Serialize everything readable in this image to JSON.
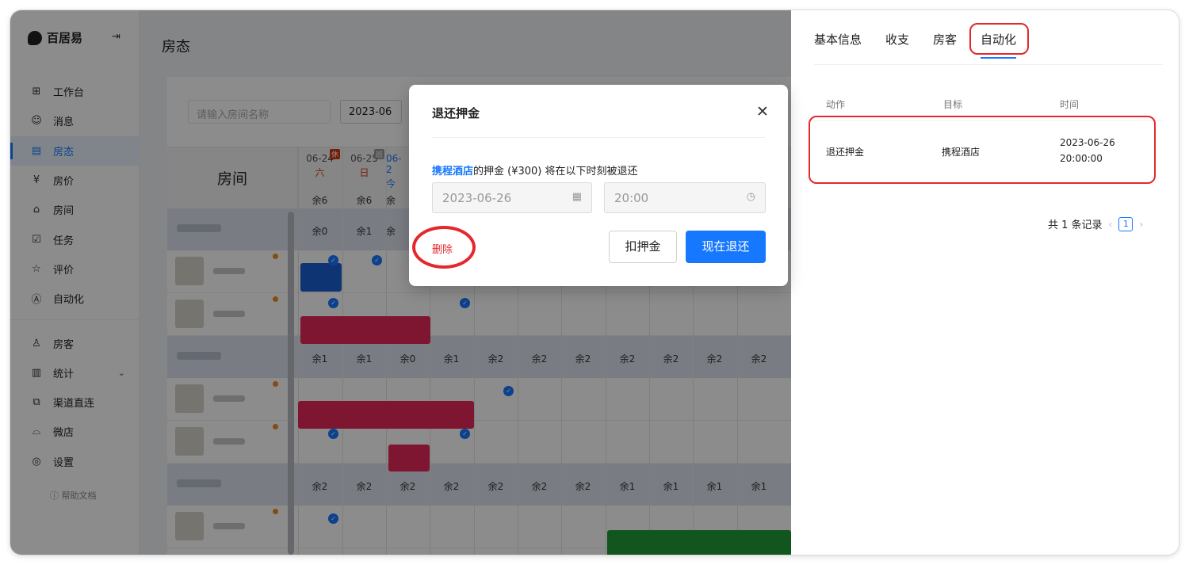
{
  "app": {
    "brand": "百居易",
    "page_title": "房态"
  },
  "sidebar": {
    "items": [
      {
        "label": "工作台",
        "icon": "dashboard-icon"
      },
      {
        "label": "消息",
        "icon": "message-icon"
      },
      {
        "label": "房态",
        "icon": "calendar-icon",
        "active": true
      },
      {
        "label": "房价",
        "icon": "yen-icon"
      },
      {
        "label": "房间",
        "icon": "room-icon"
      },
      {
        "label": "任务",
        "icon": "task-icon"
      },
      {
        "label": "评价",
        "icon": "star-icon"
      },
      {
        "label": "自动化",
        "icon": "automation-icon"
      }
    ],
    "items2": [
      {
        "label": "房客",
        "icon": "guest-icon"
      },
      {
        "label": "统计",
        "icon": "stats-icon"
      },
      {
        "label": "渠道直连",
        "icon": "channel-icon"
      },
      {
        "label": "微店",
        "icon": "shop-icon"
      },
      {
        "label": "设置",
        "icon": "settings-icon"
      }
    ],
    "help": "帮助文档"
  },
  "toolbar": {
    "search_placeholder": "请输入房间名称",
    "month": "2023-06"
  },
  "calendar": {
    "room_header": "房间",
    "days": [
      {
        "date": "06-24",
        "weekday": "六",
        "tag": "休",
        "remain": "余6"
      },
      {
        "date": "06-25",
        "weekday": "日",
        "tag": "班",
        "remain": "余6"
      },
      {
        "date": "06-2",
        "weekday": "今",
        "tag": "",
        "remain": "余"
      }
    ],
    "group_rows": [
      [
        "余0",
        "余1",
        "余"
      ],
      [
        "余1",
        "余1",
        "余0",
        "余1",
        "余2",
        "余2",
        "余2",
        "余2",
        "余2",
        "余2",
        "余2"
      ],
      [
        "余2",
        "余2",
        "余2",
        "余2",
        "余2",
        "余2",
        "余2",
        "余1",
        "余1",
        "余1",
        "余1"
      ]
    ]
  },
  "right_panel": {
    "tabs": [
      "基本信息",
      "收支",
      "房客",
      "自动化"
    ],
    "active_tab": "自动化",
    "columns": [
      "动作",
      "目标",
      "时间"
    ],
    "rows": [
      {
        "action": "退还押金",
        "target": "携程酒店",
        "date": "2023-06-26",
        "time": "20:00:00"
      }
    ],
    "pager": {
      "total": "共 1 条记录",
      "page": "1"
    }
  },
  "modal": {
    "title": "退还押金",
    "desc_highlight": "携程酒店",
    "desc_rest": "的押金 (¥300) 将在以下时刻被退还",
    "date": "2023-06-26",
    "time": "20:00",
    "delete_label": "删除",
    "deduct_label": "扣押金",
    "return_label": "现在退还"
  },
  "colors": {
    "primary": "#1677ff",
    "annotation": "#e5282c"
  }
}
